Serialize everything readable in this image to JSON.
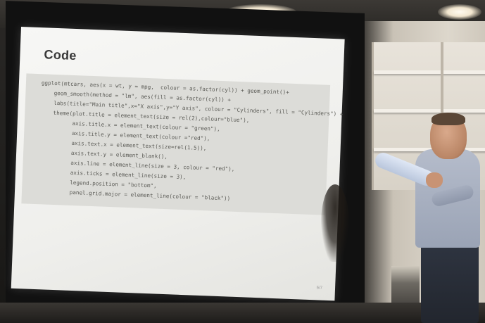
{
  "slide": {
    "title": "Code",
    "code_lines": [
      "ggplot(mtcars, aes(x = wt, y = mpg,  colour = as.factor(cyl)) + geom_point()+",
      "    geom_smooth(method = \"lm\", aes(fill = as.factor(cyl)) +",
      "    labs(title=\"Main title\",x=\"X axis\",y=\"Y axis\", colour = \"Cylinders\", fill = \"Cylinders\") +",
      "    theme(plot.title = element_text(size = rel(2),colour=\"blue\"),",
      "          axis.title.x = element_text(colour = \"green\"),",
      "          axis.title.y = element_text(colour =\"red\"),",
      "          axis.text.x = element_text(size=rel(1.5)),",
      "          axis.text.y = element_blank(),",
      "          axis.line = element_line(size = 3, colour = \"red\"),",
      "          axis.ticks = element_line(size = 3),",
      "          legend.position = \"bottom\",",
      "          panel.grid.major = element_line(colour = \"black\"))"
    ],
    "page_number": "6/7"
  },
  "colors": {
    "screen": "#f2f2ef",
    "code_background": "#dcdcd8",
    "code_text": "#5a5a55",
    "shirt": "#a9b1c2"
  }
}
